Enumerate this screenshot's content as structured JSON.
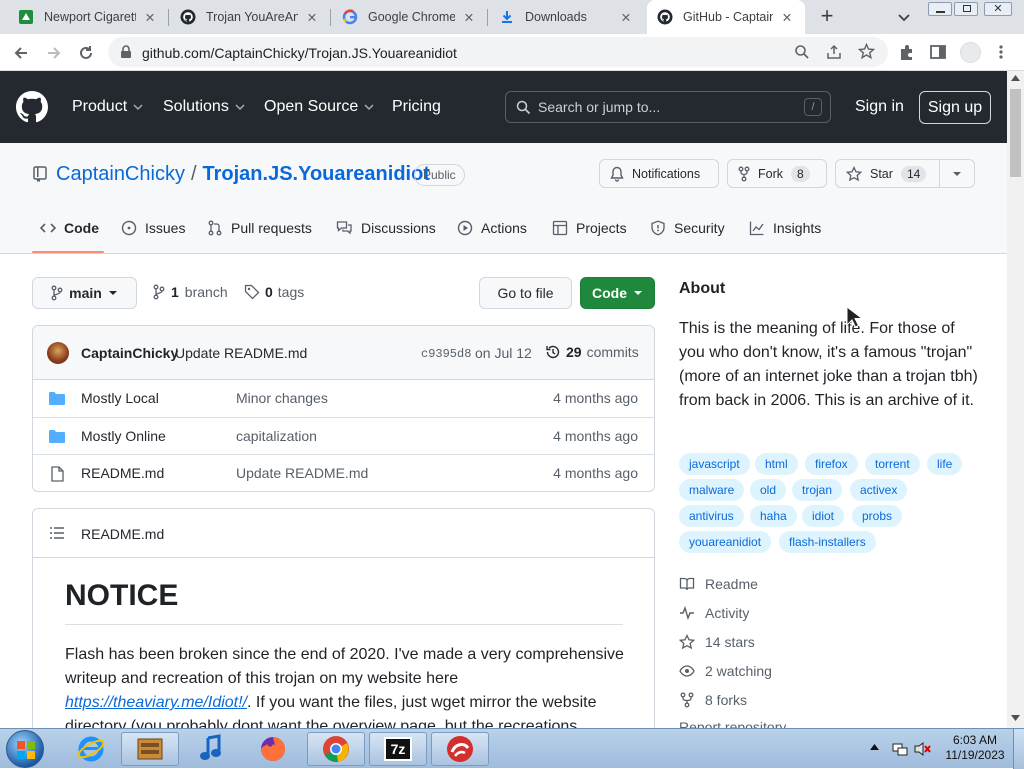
{
  "browser": {
    "tabs": [
      {
        "title": "Newport Cigarettes",
        "icon": "green-box-icon"
      },
      {
        "title": "Trojan YouAreAnIdiot",
        "icon": "github-icon"
      },
      {
        "title": "Google Chrome b",
        "icon": "google-icon"
      },
      {
        "title": "Downloads",
        "icon": "download-icon"
      },
      {
        "title": "GitHub - CaptainC",
        "icon": "github-icon",
        "active": true
      }
    ],
    "url": "github.com/CaptainChicky/Trojan.JS.Youareanidiot"
  },
  "github_header": {
    "nav": [
      "Product",
      "Solutions",
      "Open Source",
      "Pricing"
    ],
    "search_placeholder": "Search or jump to...",
    "search_key": "/",
    "sign_in": "Sign in",
    "sign_up": "Sign up"
  },
  "repo": {
    "owner": "CaptainChicky",
    "separator": "/",
    "name": "Trojan.JS.Youareanidiot",
    "visibility": "Public",
    "notifications_label": "Notifications",
    "fork_label": "Fork",
    "fork_count": "8",
    "star_label": "Star",
    "star_count": "14"
  },
  "repo_tabs": [
    "Code",
    "Issues",
    "Pull requests",
    "Discussions",
    "Actions",
    "Projects",
    "Security",
    "Insights"
  ],
  "branch_bar": {
    "branch": "main",
    "branch_count": "1",
    "branch_word": "branch",
    "tag_count": "0",
    "tag_word": "tags",
    "go_to_file": "Go to file",
    "code_button": "Code"
  },
  "latest_commit": {
    "author": "CaptainChicky",
    "message": "Update README.md",
    "hash": "c9395d8",
    "date": "on Jul 12",
    "commit_count": "29",
    "commit_word": "commits"
  },
  "files": [
    {
      "name": "Mostly Local",
      "type": "folder",
      "message": "Minor changes",
      "age": "4 months ago"
    },
    {
      "name": "Mostly Online",
      "type": "folder",
      "message": "capitalization",
      "age": "4 months ago"
    },
    {
      "name": "README.md",
      "type": "file",
      "message": "Update README.md",
      "age": "4 months ago"
    }
  ],
  "readme": {
    "filename": "README.md",
    "heading": "NOTICE",
    "para_before_link": "Flash has been broken since the end of 2020. I've made a very comprehensive writeup and recreation of this trojan on my website here",
    "link": "https://theaviary.me/Idiot!/",
    "para_after_link": ". If you want the files, just wget mirror the website directory (you probably dont want the overview page, but the recreations"
  },
  "about": {
    "heading": "About",
    "description": "This is the meaning of life. For those of you who don't know, it's a famous \"trojan\" (more of an internet joke than a trojan tbh) from back in 2006. This is an archive of it.",
    "topics": [
      "javascript",
      "html",
      "firefox",
      "torrent",
      "life",
      "malware",
      "old",
      "trojan",
      "activex",
      "antivirus",
      "haha",
      "idiot",
      "probs",
      "youareanidiot",
      "flash-installers"
    ],
    "links": [
      {
        "label": "Readme",
        "icon": "book-icon"
      },
      {
        "label": "Activity",
        "icon": "pulse-icon"
      },
      {
        "label": "14 stars",
        "icon": "star-icon"
      },
      {
        "label": "2 watching",
        "icon": "eye-icon"
      },
      {
        "label": "8 forks",
        "icon": "fork-icon"
      }
    ],
    "report": "Report repository"
  },
  "taskbar": {
    "time": "6:03 AM",
    "date": "11/19/2023"
  },
  "colors": {
    "gh_header": "#24292f",
    "link": "#0969da",
    "code_button": "#1f883d",
    "topic_bg": "#ddf4ff",
    "tab_underline": "#fd8c73"
  }
}
